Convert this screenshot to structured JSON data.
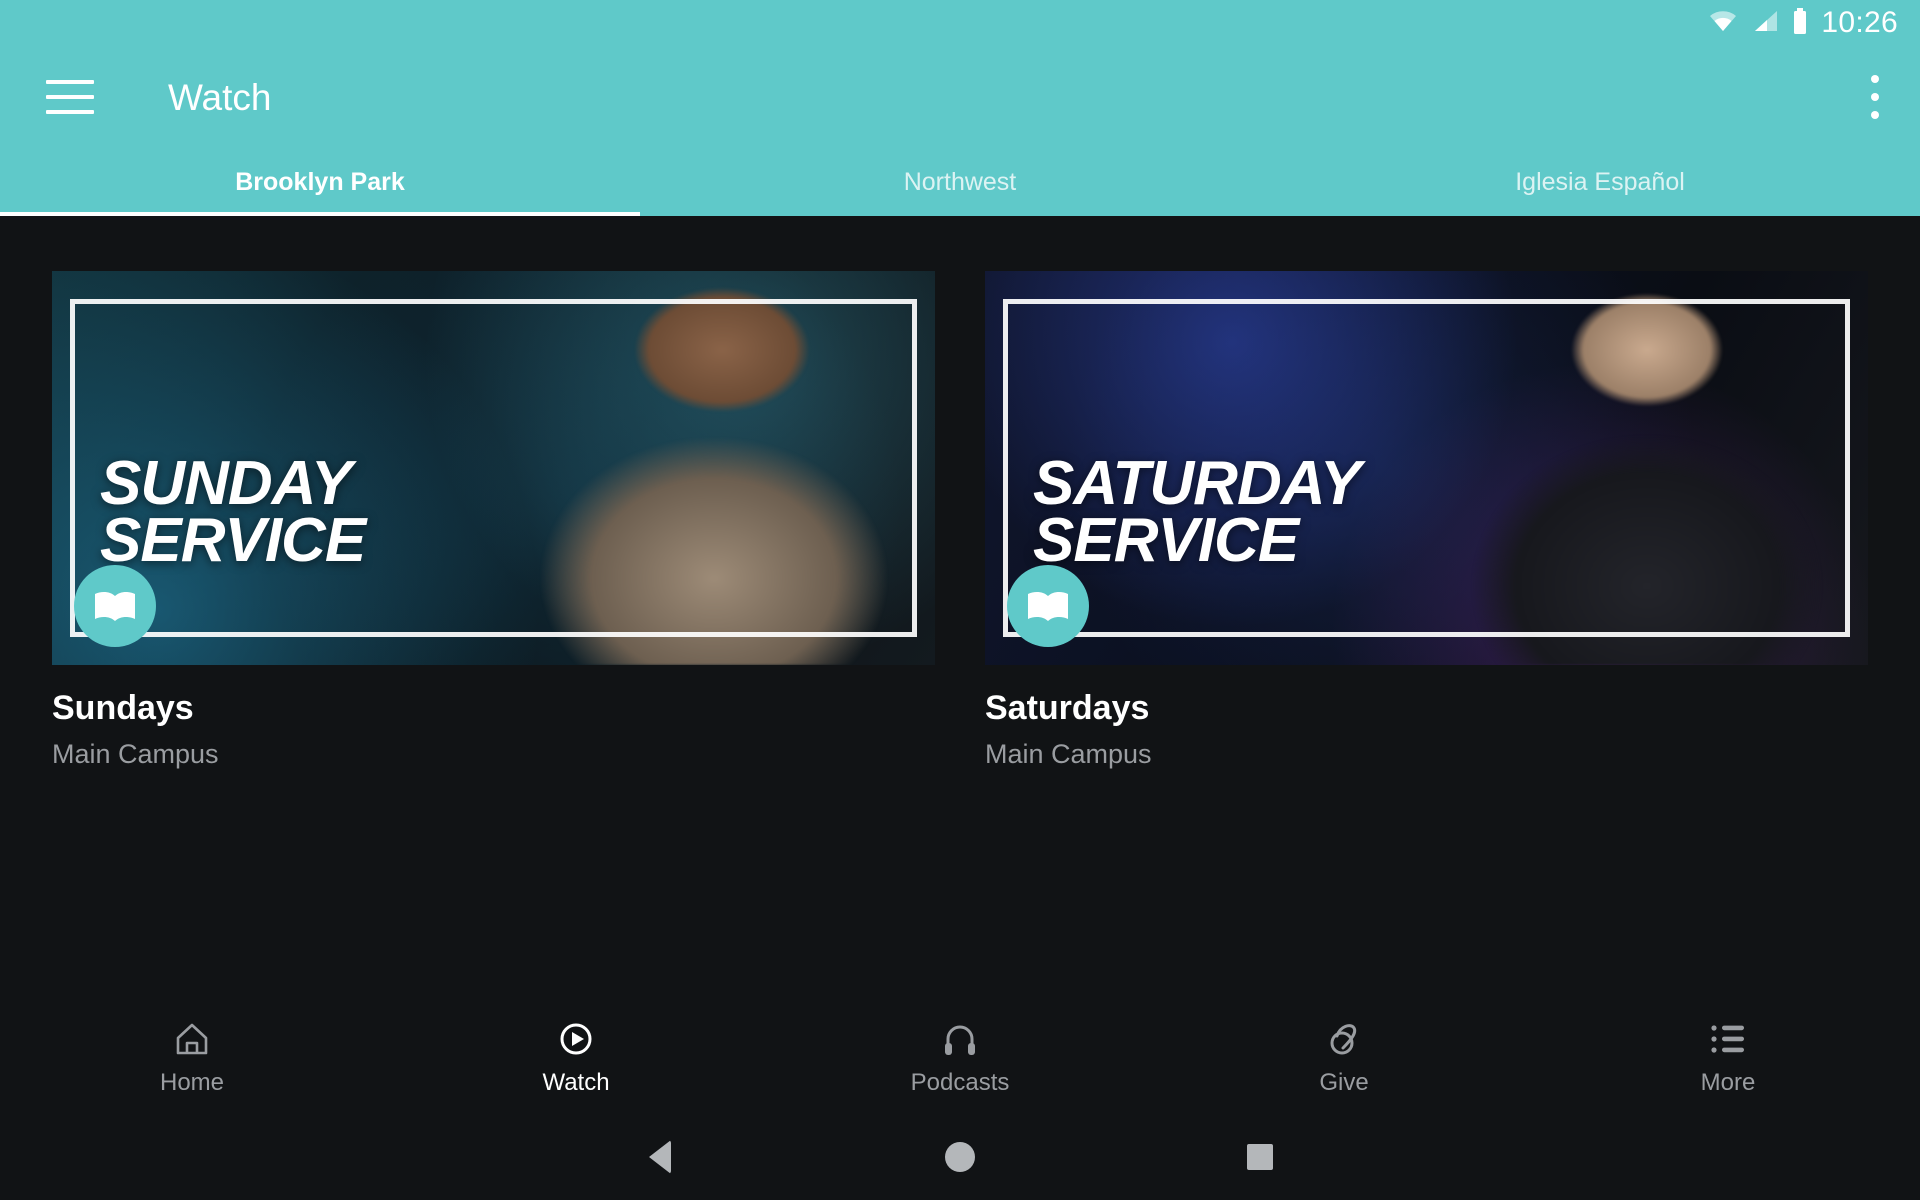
{
  "status_bar": {
    "wifi_icon": "wifi-icon",
    "signal_icon": "cellular-signal-icon",
    "battery_icon": "battery-icon",
    "time": "10:26"
  },
  "app_bar": {
    "menu_icon": "hamburger-menu-icon",
    "title": "Watch",
    "overflow_icon": "overflow-menu-icon",
    "background_color": "#5FC9C9"
  },
  "tabs": [
    {
      "label": "Brooklyn Park",
      "active": true
    },
    {
      "label": "Northwest",
      "active": false
    },
    {
      "label": "Iglesia Español",
      "active": false
    }
  ],
  "cards": [
    {
      "overlay_title": "SUNDAY\nSERVICE",
      "badge_icon": "open-book-icon",
      "title": "Sundays",
      "subtitle": "Main Campus"
    },
    {
      "overlay_title": "SATURDAY\nSERVICE",
      "badge_icon": "open-book-icon",
      "title": "Saturdays",
      "subtitle": "Main Campus"
    }
  ],
  "bottom_nav": [
    {
      "label": "Home",
      "icon": "house-icon",
      "active": false
    },
    {
      "label": "Watch",
      "icon": "play-circle-icon",
      "active": true
    },
    {
      "label": "Podcasts",
      "icon": "headphones-icon",
      "active": false
    },
    {
      "label": "Give",
      "icon": "giving-hand-icon",
      "active": false
    },
    {
      "label": "More",
      "icon": "list-bullets-icon",
      "active": false
    }
  ],
  "system_nav": {
    "back": "back-triangle-icon",
    "home": "home-circle-icon",
    "recents": "recents-square-icon"
  },
  "colors": {
    "accent_teal": "#5FC9C9",
    "background_dark": "#111315",
    "text_muted": "#9A9DA1"
  }
}
